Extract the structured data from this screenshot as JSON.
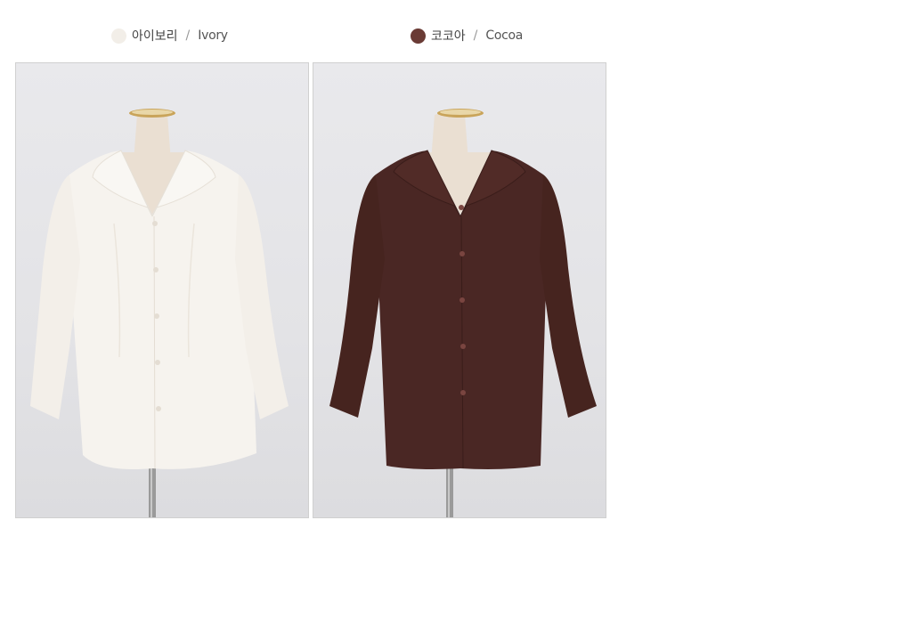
{
  "colors": [
    {
      "name_ko": "아이보리",
      "separator": "/",
      "name_en": "Ivory",
      "swatch": "#f2eee8",
      "garment": "#f6f3ee",
      "garment_shade": "#e7e2da",
      "button": "#e4ddd3"
    },
    {
      "name_ko": "코코아",
      "separator": "/",
      "name_en": "Cocoa",
      "swatch": "#6a3b35",
      "garment": "#4a2724",
      "garment_shade": "#3a1d1a",
      "button": "#5c2f2b"
    }
  ],
  "page": {
    "background": "#ffffff"
  },
  "photos": [
    {
      "subject": "ivory-blouse-on-mannequin"
    },
    {
      "subject": "cocoa-blouse-on-mannequin"
    }
  ]
}
